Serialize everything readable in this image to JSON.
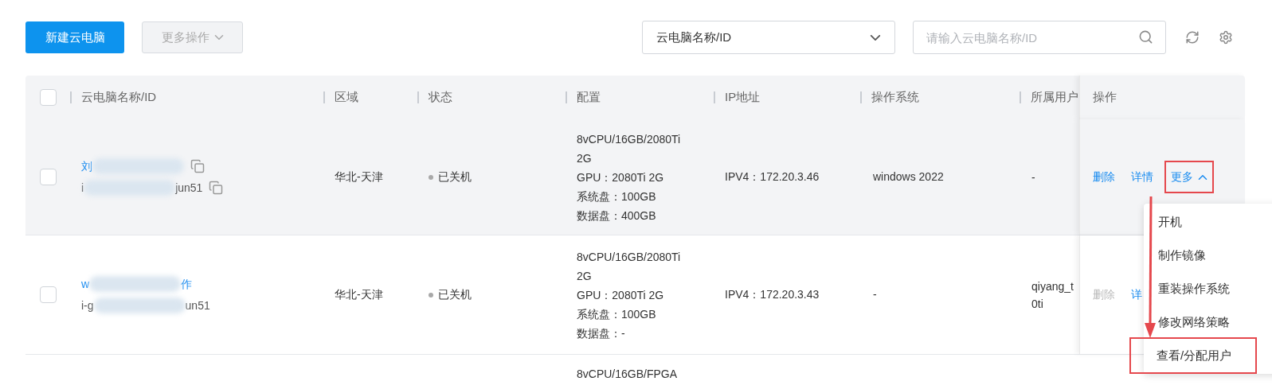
{
  "toolbar": {
    "create_button": "新建云电脑",
    "more_button": {
      "label": "更多操作",
      "disabled": true
    },
    "filter_select": {
      "value": "云电脑名称/ID"
    },
    "search": {
      "placeholder": "请输入云电脑名称/ID"
    }
  },
  "table": {
    "select_all_checked": false,
    "columns": [
      "云电脑名称/ID",
      "区域",
      "状态",
      "配置",
      "IP地址",
      "操作系统",
      "所属用户",
      "操作"
    ],
    "rows": [
      {
        "hovered": true,
        "checked": false,
        "copy_icon": true,
        "name": [
          {
            "kind": "text",
            "text": "刘"
          },
          {
            "kind": "redacted"
          }
        ],
        "id": [
          {
            "kind": "text",
            "text": "i"
          },
          {
            "kind": "redacted"
          },
          {
            "kind": "text",
            "text": "jun51"
          }
        ],
        "region": "华北-天津",
        "status": "已关机",
        "config": [
          "8vCPU/16GB/2080Ti",
          "2G",
          "GPU：2080Ti 2G",
          "系统盘：100GB",
          "数据盘：400GB"
        ],
        "ip": "IPV4：172.20.3.46",
        "os": "windows 2022",
        "owner": [
          "-"
        ],
        "actions": [
          {
            "label": "删除",
            "disabled": false,
            "highlighted": false
          },
          {
            "label": "详情",
            "disabled": false,
            "highlighted": false
          },
          {
            "label": "更多",
            "disabled": false,
            "highlighted": true,
            "expanded": true
          }
        ]
      },
      {
        "hovered": false,
        "checked": false,
        "copy_icon": false,
        "name": [
          {
            "kind": "text",
            "text": "w"
          },
          {
            "kind": "redacted"
          },
          {
            "kind": "text",
            "text": "作"
          }
        ],
        "id": [
          {
            "kind": "text",
            "text": "i-g"
          },
          {
            "kind": "redacted"
          },
          {
            "kind": "text",
            "text": "un51"
          }
        ],
        "region": "华北-天津",
        "status": "已关机",
        "config": [
          "8vCPU/16GB/2080Ti",
          "2G",
          "GPU：2080Ti 2G",
          "系统盘：100GB",
          "数据盘：-"
        ],
        "ip": "IPV4：172.20.3.43",
        "os": "-",
        "owner": [
          "qiyang_t",
          "0ti"
        ],
        "actions": [
          {
            "label": "删除",
            "disabled": true,
            "highlighted": false
          },
          {
            "label": "详",
            "disabled": false,
            "highlighted": false
          }
        ]
      },
      {
        "hovered": false,
        "config": [
          "8vCPU/16GB/FPGA"
        ]
      }
    ]
  },
  "more_menu": [
    {
      "label": "开机",
      "highlighted": false
    },
    {
      "label": "制作镜像",
      "highlighted": false
    },
    {
      "label": "重装操作系统",
      "highlighted": false
    },
    {
      "label": "修改网络策略",
      "highlighted": false
    },
    {
      "label": "查看/分配用户",
      "highlighted": true
    }
  ]
}
